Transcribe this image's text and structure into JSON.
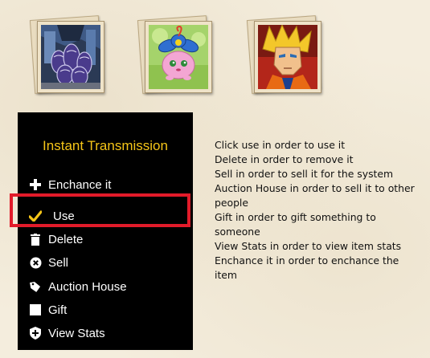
{
  "cards": [
    {
      "name": "shadow-tentacles"
    },
    {
      "name": "pink-flower-creature"
    },
    {
      "name": "blonde-warrior"
    }
  ],
  "menu": {
    "title": "Instant Transmission",
    "items": [
      {
        "label": "Enchance it",
        "icon": "plus-icon"
      },
      {
        "label": "Use",
        "icon": "check-icon"
      },
      {
        "label": "Delete",
        "icon": "trash-icon"
      },
      {
        "label": "Sell",
        "icon": "x-circle-icon"
      },
      {
        "label": "Auction House",
        "icon": "tag-icon"
      },
      {
        "label": "Gift",
        "icon": "square-icon"
      },
      {
        "label": "View Stats",
        "icon": "shield-icon"
      }
    ]
  },
  "help": {
    "lines": [
      "Click use in order to use it",
      "Delete in order to remove it",
      "Sell in order to sell it for the system",
      "Auction House in order to sell it to other",
      "people",
      "Gift in order to gift something to",
      "someone",
      "View Stats in order to view item stats",
      "Enchance it in order to enchance the",
      "item"
    ]
  },
  "colors": {
    "title": "#f5c518",
    "highlight": "#e21b2a",
    "menu_bg": "#000000",
    "check": "#f5c518"
  }
}
